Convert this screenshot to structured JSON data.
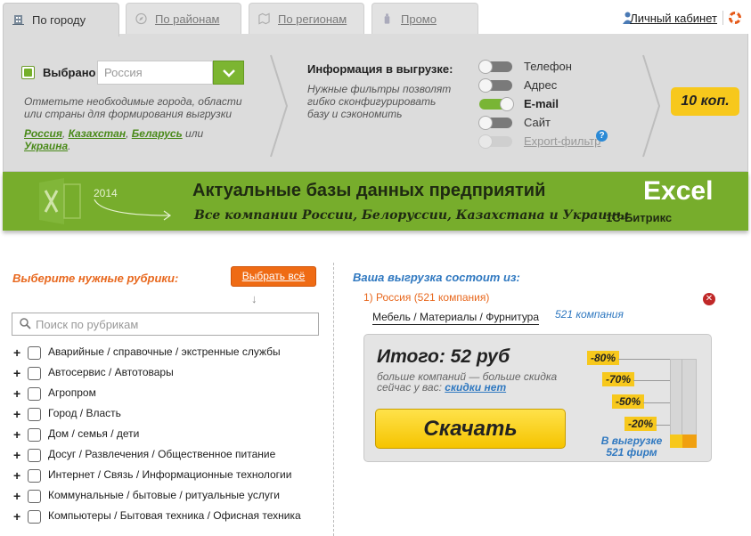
{
  "tabs": [
    {
      "label": "По городу",
      "icon": "building-icon"
    },
    {
      "label": "По районам",
      "icon": "compass-icon"
    },
    {
      "label": "По регионам",
      "icon": "map-icon"
    },
    {
      "label": "Промо",
      "icon": "bottle-icon"
    }
  ],
  "account": {
    "label": "Личный кабинет",
    "icon": "user-icon",
    "help_icon": "lifebuoy-icon"
  },
  "filter": {
    "selected_label": "Выбрано",
    "country_placeholder": "Россия",
    "hint": "Отметьте необходимые города, области или страны для формирования выгрузки",
    "countries": [
      "Россия",
      "Казахстан",
      "Беларусь",
      "Украина"
    ],
    "sep1": ", ",
    "or_word": " или ",
    "end": ".",
    "export_info_title": "Информация в выгрузке:",
    "export_info_hint": "Нужные фильтры позволят гибко сконфигурировать базу и сэкономить",
    "toggles": [
      {
        "label": "Телефон",
        "state": "off"
      },
      {
        "label": "Адрес",
        "state": "off"
      },
      {
        "label": "E-mail",
        "state": "on"
      },
      {
        "label": "Сайт",
        "state": "off"
      },
      {
        "label": "Export-фильтр",
        "state": "disabled"
      }
    ],
    "help_glyph": "?",
    "price": "10 коп."
  },
  "banner": {
    "year": "2014",
    "title": "Актуальные базы данных предприятий",
    "subtitle": "Все компании России, Белоруссии, Казахстана и Украины",
    "excel": "Excel",
    "bitrix": "1С-Битрикс",
    "colors": {
      "bg": "#77ad2c"
    }
  },
  "rubrics": {
    "title": "Выберите нужные рубрики:",
    "select_all": "Выбрать всё",
    "search_placeholder": "Поиск по рубрикам",
    "items": [
      "Аварийные / справочные / экстренные службы",
      "Автосервис / Автотовары",
      "Агропром",
      "Город / Власть",
      "Дом / семья / дети",
      "Досуг / Развлечения / Общественное питание",
      "Интернет / Связь / Информационные технологии",
      "Коммунальные / бытовые / ритуальные услуги",
      "Компьютеры / Бытовая техника / Офисная техника"
    ]
  },
  "export": {
    "title": "Ваша выгрузка состоит из:",
    "item": "1) Россия (521 компания)",
    "category": "Мебель / Материалы / Фурнитура",
    "category_count": "521 компания",
    "total": "Итого: 52 руб",
    "hint": "больше компаний — больше скидка сейчас у вас:",
    "discount_link": "скидки нет",
    "download": "Скачать",
    "discounts": [
      "-80%",
      "-70%",
      "-50%",
      "-20%"
    ],
    "in_export": "В выгрузке 521 фирм",
    "fill_fraction": 0.15
  }
}
